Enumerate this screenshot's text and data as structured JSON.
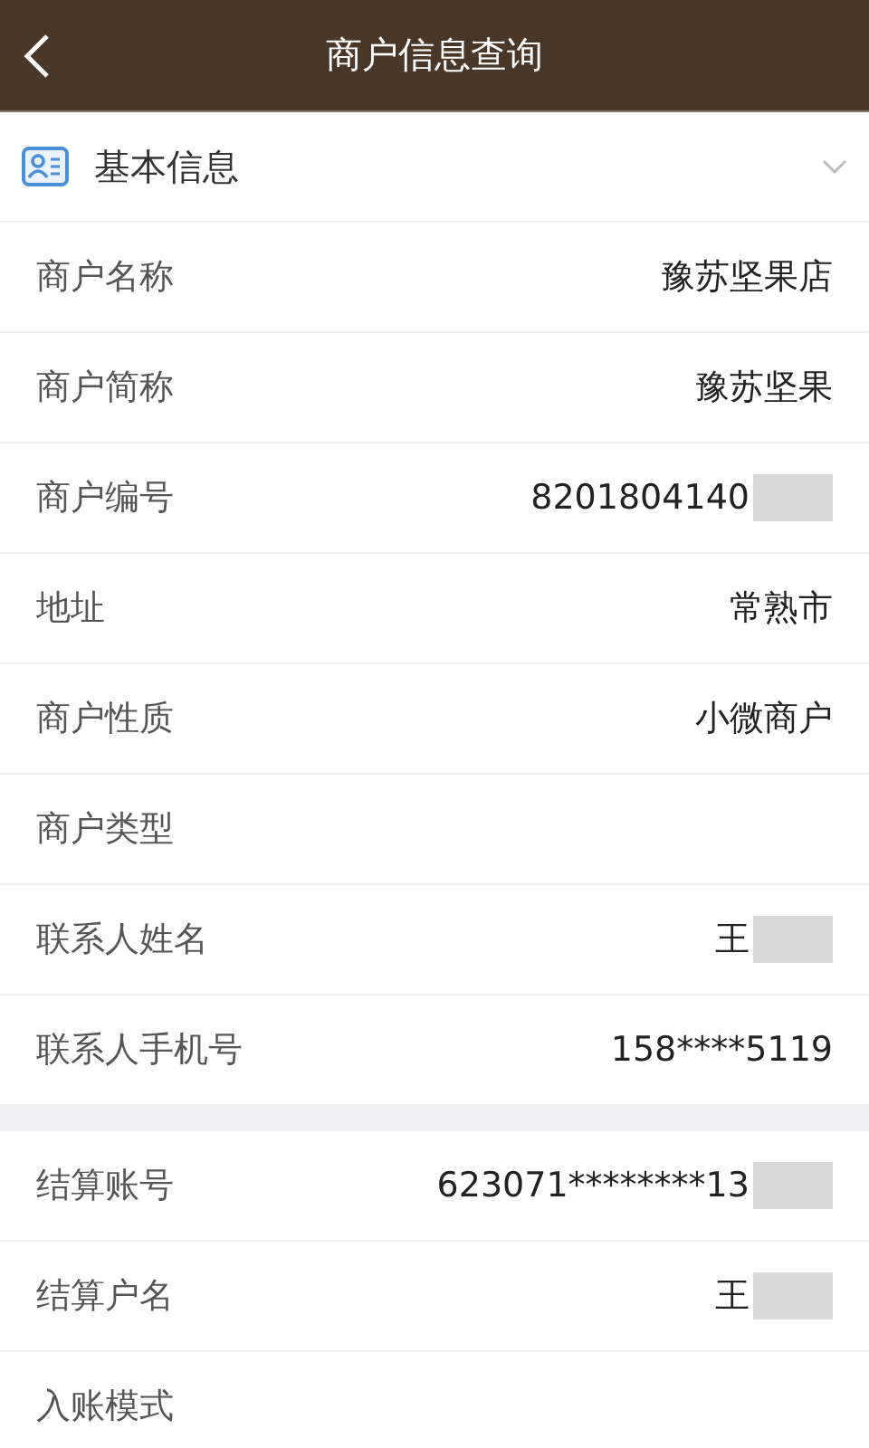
{
  "header": {
    "title": "商户信息查询"
  },
  "section": {
    "title": "基本信息"
  },
  "groups": [
    {
      "rows": [
        {
          "label": "商户名称",
          "value": "豫苏坚果店"
        },
        {
          "label": "商户简称",
          "value": "豫苏坚果"
        },
        {
          "label": "商户编号",
          "value": "8201804140",
          "redacted": true
        },
        {
          "label": "地址",
          "value": "常熟市"
        },
        {
          "label": "商户性质",
          "value": "小微商户"
        },
        {
          "label": "商户类型"
        },
        {
          "label": "联系人姓名",
          "value": "王",
          "redacted": true
        },
        {
          "label": "联系人手机号",
          "value": "158****5119"
        }
      ]
    },
    {
      "rows": [
        {
          "label": "结算账号",
          "value": "623071********13",
          "redacted": true
        },
        {
          "label": "结算户名",
          "value": "王",
          "redacted": true
        },
        {
          "label": "入账模式"
        }
      ]
    }
  ]
}
